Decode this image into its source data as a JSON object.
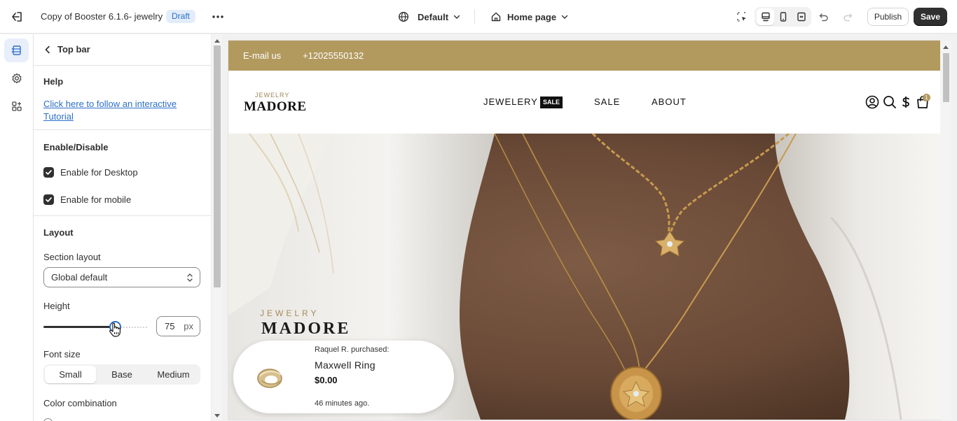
{
  "header": {
    "theme_name": "Copy of Booster 6.1.6- jewelry",
    "status_badge": "Draft",
    "language": "Default",
    "page": "Home page",
    "publish_label": "Publish",
    "save_label": "Save"
  },
  "panel": {
    "title": "Top bar",
    "help": {
      "heading": "Help",
      "link_text": "Click here to follow an interactive Tutorial"
    },
    "enable": {
      "heading": "Enable/Disable",
      "desktop_label": "Enable for Desktop",
      "desktop_checked": true,
      "mobile_label": "Enable for mobile",
      "mobile_checked": true
    },
    "layout": {
      "heading": "Layout",
      "section_layout_label": "Section layout",
      "section_layout_value": "Global default",
      "height_label": "Height",
      "height_value": "75",
      "height_unit": "px",
      "font_size_label": "Font size",
      "font_size_options": [
        "Small",
        "Base",
        "Medium"
      ],
      "font_size_selected": "Small",
      "color_label": "Color combination"
    }
  },
  "preview": {
    "promo": {
      "email": "E-mail us",
      "phone": "+12025550132",
      "color": "#b29a5f"
    },
    "logo": {
      "small": "JEWELRY",
      "big": "MADORE"
    },
    "nav": {
      "jewelery": "JEWELERY",
      "badge": "SALE",
      "sale": "SALE",
      "about": "ABOUT"
    },
    "cart_count": "1",
    "hero": {
      "brand_small": "JEWELRY",
      "brand_big": "MADORE"
    },
    "popup": {
      "who": "Raquel R. purchased:",
      "product": "Maxwell Ring",
      "price": "$0.00",
      "time": "46 minutes ago."
    }
  }
}
